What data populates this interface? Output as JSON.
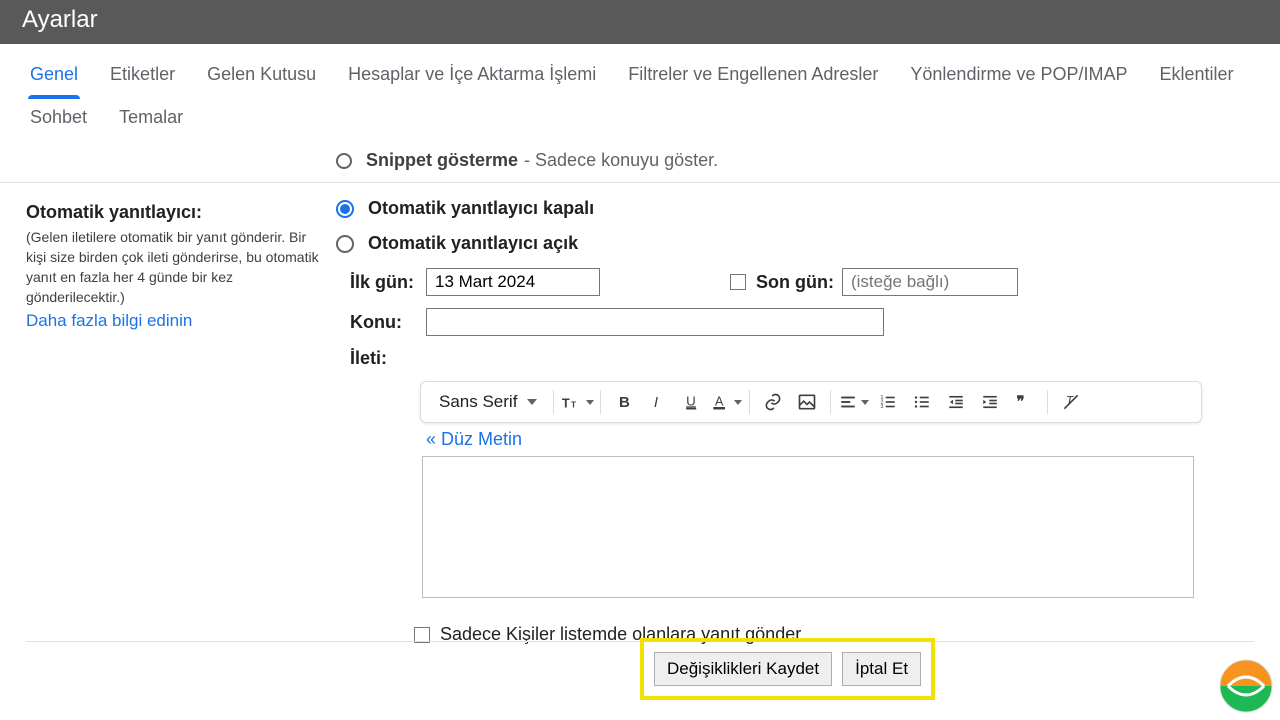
{
  "header": {
    "title": "Ayarlar"
  },
  "tabs": [
    "Genel",
    "Etiketler",
    "Gelen Kutusu",
    "Hesaplar ve İçe Aktarma İşlemi",
    "Filtreler ve Engellenen Adresler",
    "Yönlendirme ve POP/IMAP",
    "Eklentiler",
    "Sohbet",
    "Temalar"
  ],
  "activeTab": 0,
  "snippet": {
    "label": "Snippet gösterme",
    "note": "- Sadece konuyu göster."
  },
  "autoresponder": {
    "title": "Otomatik yanıtlayıcı:",
    "note": "(Gelen iletilere otomatik bir yanıt gönderir. Bir kişi size birden çok ileti gönderirse, bu otomatik yanıt en fazla her 4 günde bir kez gönderilecektir.)",
    "learnMore": "Daha fazla bilgi edinin",
    "offLabel": "Otomatik yanıtlayıcı kapalı",
    "onLabel": "Otomatik yanıtlayıcı açık",
    "selected": "off",
    "firstDayLabel": "İlk gün:",
    "firstDayValue": "13 Mart 2024",
    "lastDayLabel": "Son gün:",
    "lastDayPlaceholder": "(isteğe bağlı)",
    "subjectLabel": "Konu:",
    "subjectValue": "",
    "messageLabel": "İleti:",
    "plainTextLink": "« Düz Metin",
    "fontName": "Sans Serif",
    "contactsOnlyLabel": "Sadece Kişiler listemde olanlara yanıt gönder"
  },
  "footer": {
    "save": "Değişiklikleri Kaydet",
    "cancel": "İptal Et"
  }
}
